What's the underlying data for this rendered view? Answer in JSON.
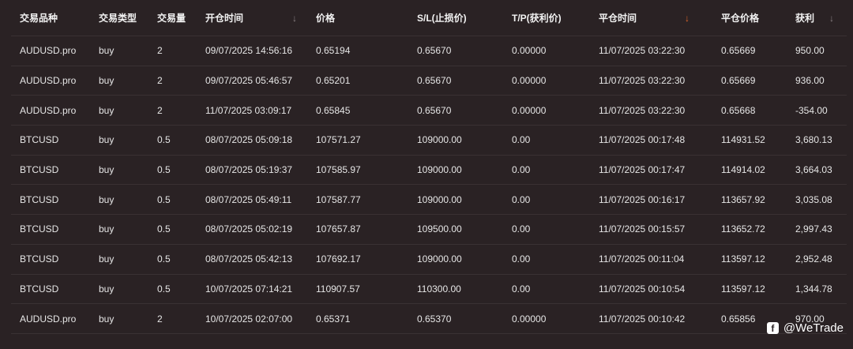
{
  "columns": [
    "交易品种",
    "交易类型",
    "交易量",
    "开仓时间",
    "价格",
    "S/L(止损价)",
    "T/P(获利价)",
    "平仓时间",
    "平仓价格",
    "获利"
  ],
  "sort_icons": {
    "open_time": "↓",
    "close_time": "↓",
    "profit": "↓"
  },
  "accent_color": "#e0662a",
  "rows": [
    [
      "AUDUSD.pro",
      "buy",
      "2",
      "09/07/2025 14:56:16",
      "0.65194",
      "0.65670",
      "0.00000",
      "11/07/2025 03:22:30",
      "0.65669",
      "950.00"
    ],
    [
      "AUDUSD.pro",
      "buy",
      "2",
      "09/07/2025 05:46:57",
      "0.65201",
      "0.65670",
      "0.00000",
      "11/07/2025 03:22:30",
      "0.65669",
      "936.00"
    ],
    [
      "AUDUSD.pro",
      "buy",
      "2",
      "11/07/2025 03:09:17",
      "0.65845",
      "0.65670",
      "0.00000",
      "11/07/2025 03:22:30",
      "0.65668",
      "-354.00"
    ],
    [
      "BTCUSD",
      "buy",
      "0.5",
      "08/07/2025 05:09:18",
      "107571.27",
      "109000.00",
      "0.00",
      "11/07/2025 00:17:48",
      "114931.52",
      "3,680.13"
    ],
    [
      "BTCUSD",
      "buy",
      "0.5",
      "08/07/2025 05:19:37",
      "107585.97",
      "109000.00",
      "0.00",
      "11/07/2025 00:17:47",
      "114914.02",
      "3,664.03"
    ],
    [
      "BTCUSD",
      "buy",
      "0.5",
      "08/07/2025 05:49:11",
      "107587.77",
      "109000.00",
      "0.00",
      "11/07/2025 00:16:17",
      "113657.92",
      "3,035.08"
    ],
    [
      "BTCUSD",
      "buy",
      "0.5",
      "08/07/2025 05:02:19",
      "107657.87",
      "109500.00",
      "0.00",
      "11/07/2025 00:15:57",
      "113652.72",
      "2,997.43"
    ],
    [
      "BTCUSD",
      "buy",
      "0.5",
      "08/07/2025 05:42:13",
      "107692.17",
      "109000.00",
      "0.00",
      "11/07/2025 00:11:04",
      "113597.12",
      "2,952.48"
    ],
    [
      "BTCUSD",
      "buy",
      "0.5",
      "10/07/2025 07:14:21",
      "110907.57",
      "110300.00",
      "0.00",
      "11/07/2025 00:10:54",
      "113597.12",
      "1,344.78"
    ],
    [
      "AUDUSD.pro",
      "buy",
      "2",
      "10/07/2025 02:07:00",
      "0.65371",
      "0.65370",
      "0.00000",
      "11/07/2025 00:10:42",
      "0.65856",
      "970.00"
    ]
  ],
  "watermark": {
    "logo_letter": "f",
    "text": "@WeTrade"
  }
}
